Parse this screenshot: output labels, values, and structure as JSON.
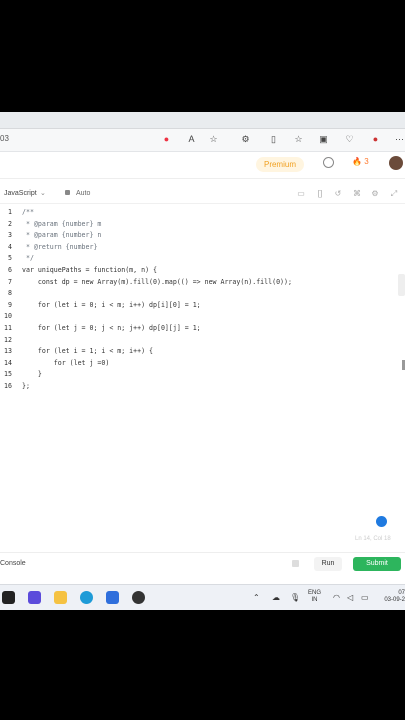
{
  "browser": {
    "url_fragment": "03",
    "icons": [
      "notification-badge-icon",
      "read-aloud-icon",
      "favorite-star-icon",
      "extensions-icon",
      "split-screen-icon",
      "favorites-icon",
      "collections-icon",
      "health-icon",
      "profile-icon",
      "more-icon"
    ]
  },
  "header": {
    "premium_label": "Premium",
    "streak_count": "3"
  },
  "toolbar": {
    "language": "JavaScript",
    "mode": "Auto"
  },
  "editor": {
    "lines": [
      {
        "n": "1",
        "text": "/**"
      },
      {
        "n": "2",
        "text": " * @param {number} m"
      },
      {
        "n": "3",
        "text": " * @param {number} n"
      },
      {
        "n": "4",
        "text": " * @return {number}"
      },
      {
        "n": "5",
        "text": " */"
      },
      {
        "n": "6",
        "text": "var uniquePaths = function(m, n) {"
      },
      {
        "n": "7",
        "text": "    const dp = new Array(m).fill(0).map(() => new Array(n).fill(0));"
      },
      {
        "n": "8",
        "text": ""
      },
      {
        "n": "9",
        "text": "    for (let i = 0; i < m; i++) dp[i][0] = 1;"
      },
      {
        "n": "10",
        "text": ""
      },
      {
        "n": "11",
        "text": "    for (let j = 0; j < n; j++) dp[0][j] = 1;"
      },
      {
        "n": "12",
        "text": ""
      },
      {
        "n": "13",
        "text": "    for (let i = 1; i < m; i++) {"
      },
      {
        "n": "14",
        "text": "        for (let j =0)"
      },
      {
        "n": "15",
        "text": "    }"
      },
      {
        "n": "16",
        "text": "};"
      }
    ],
    "cursor_info": "Ln 14, Col 18"
  },
  "console_bar": {
    "console_label": "Console",
    "run_label": "Run",
    "submit_label": "Submit"
  },
  "taskbar": {
    "lang_top": "ENG",
    "lang_bottom": "IN",
    "time": "07",
    "date": "03-09-2"
  },
  "colors": {
    "submit_green": "#2db55d",
    "premium_orange": "#f0a020",
    "keyword": "#a626a4"
  }
}
